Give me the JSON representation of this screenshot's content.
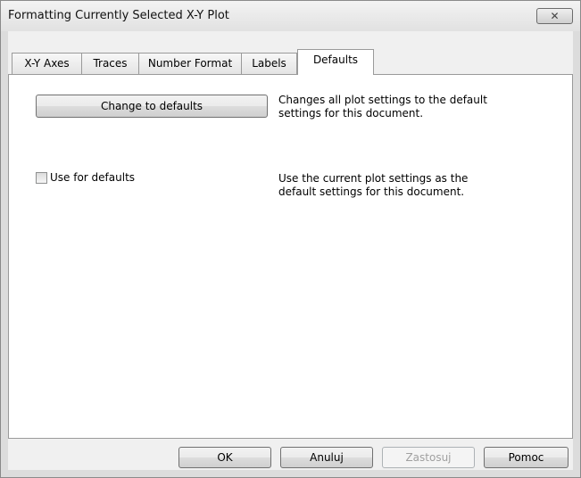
{
  "window": {
    "title": "Formatting Currently Selected X-Y Plot",
    "close_label": "✕"
  },
  "tabs": [
    {
      "label": "X-Y Axes",
      "active": false
    },
    {
      "label": "Traces",
      "active": false
    },
    {
      "label": "Number Format",
      "active": false
    },
    {
      "label": "Labels",
      "active": false
    },
    {
      "label": "Defaults",
      "active": true
    }
  ],
  "defaults_panel": {
    "change_button_label": "Change to defaults",
    "change_description_line1": "Changes all plot settings to the default",
    "change_description_line2": "settings for this document.",
    "use_checkbox_label": "Use for defaults",
    "use_checkbox_checked": false,
    "use_description_line1": "Use the current plot settings as the",
    "use_description_line2": "default settings for this document."
  },
  "footer": {
    "ok_label": "OK",
    "cancel_label": "Anuluj",
    "apply_label": "Zastosuj",
    "help_label": "Pomoc"
  }
}
